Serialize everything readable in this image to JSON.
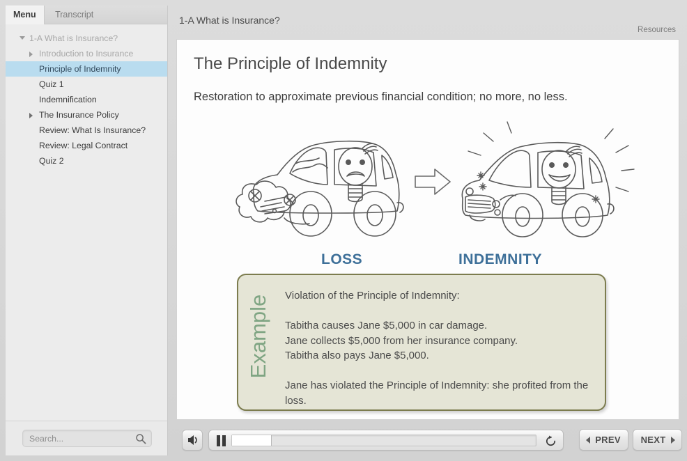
{
  "window": {
    "background": "#d9d9d9"
  },
  "sidebar": {
    "tabs": [
      {
        "label": "Menu",
        "active": true
      },
      {
        "label": "Transcript",
        "active": false
      }
    ],
    "tree": [
      {
        "label": "1-A What is Insurance?",
        "level": 0,
        "state": "expanded",
        "dim": true,
        "selected": false
      },
      {
        "label": "Introduction to Insurance",
        "level": 1,
        "state": "collapsed",
        "dim": true,
        "selected": false
      },
      {
        "label": "Principle of Indemnity",
        "level": 1,
        "state": "leaf",
        "dim": false,
        "selected": true
      },
      {
        "label": "Quiz 1",
        "level": 1,
        "state": "leaf",
        "dim": false,
        "selected": false
      },
      {
        "label": "Indemnification",
        "level": 1,
        "state": "leaf",
        "dim": false,
        "selected": false
      },
      {
        "label": "The Insurance Policy",
        "level": 1,
        "state": "collapsed",
        "dim": false,
        "selected": false
      },
      {
        "label": "Review: What Is Insurance?",
        "level": 1,
        "state": "leaf",
        "dim": false,
        "selected": false
      },
      {
        "label": "Review: Legal Contract",
        "level": 1,
        "state": "leaf",
        "dim": false,
        "selected": false
      },
      {
        "label": "Quiz 2",
        "level": 1,
        "state": "leaf",
        "dim": false,
        "selected": false
      }
    ],
    "search": {
      "value": "",
      "placeholder": "Search...",
      "icon": "search-icon"
    },
    "highlight_color": "#b9dcef"
  },
  "header": {
    "course_title": "1-A What is Insurance?",
    "resources_label": "Resources"
  },
  "slide": {
    "title": "The Principle of Indemnity",
    "subtitle": "Restoration to approximate previous financial condition; no more, no less.",
    "caption_left": "LOSS",
    "caption_right": "INDEMNITY",
    "caption_color": "#3e7099",
    "illustration": {
      "left": "damaged-car-sad-driver-doodle",
      "right": "repaired-car-happy-driver-doodle",
      "middle": "right-arrow-doodle"
    },
    "example": {
      "label": "Example",
      "label_color": "#7fa583",
      "border_color": "#7c7c4e",
      "background_color": "#e5e5d6",
      "body": "Violation of the Principle of Indemnity:\n\nTabitha causes Jane $5,000 in car damage.\nJane collects $5,000 from her insurance company.\nTabitha also pays Jane $5,000.\n\nJane has violated the Principle of Indemnity: she profited from the loss."
    }
  },
  "controls": {
    "volume_icon": "volume-icon",
    "play_state": "paused",
    "pause_icon": "pause-icon",
    "progress_percent": 13,
    "replay_icon": "replay-icon",
    "prev_label": "PREV",
    "next_label": "NEXT"
  }
}
